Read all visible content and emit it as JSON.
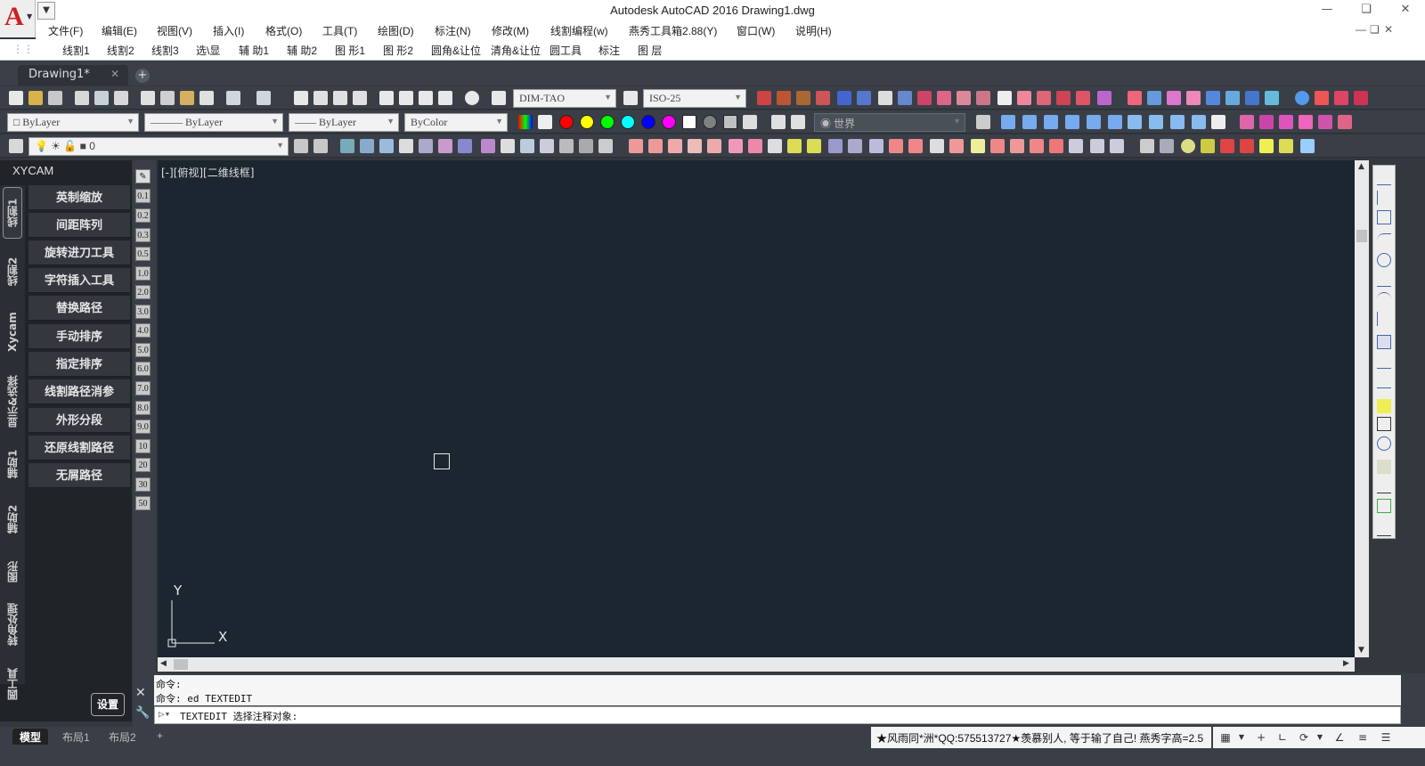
{
  "window": {
    "title": "Autodesk AutoCAD 2016    Drawing1.dwg"
  },
  "app": {
    "logo": "A"
  },
  "menu": [
    "文件(F)",
    "编辑(E)",
    "视图(V)",
    "插入(I)",
    "格式(O)",
    "工具(T)",
    "绘图(D)",
    "标注(N)",
    "修改(M)",
    "线割编程(w)",
    "燕秀工具箱2.88(Y)",
    "窗口(W)",
    "说明(H)"
  ],
  "custom_toolbar": [
    "线割1",
    "线割2",
    "线割3",
    "选\\显",
    "辅 助1",
    "辅 助2",
    "图 形1",
    "图 形2",
    "圆角&让位",
    "清角&让位",
    "圆工具",
    "标注",
    "图 层"
  ],
  "tabs": {
    "active": "Drawing1*"
  },
  "toolbar": {
    "dim_style": "DIM-TAO",
    "iso_style": "ISO-25",
    "color_combo": "ByLayer",
    "linetype_combo": "ByLayer",
    "lineweight_combo": "ByLayer",
    "plotstyle_combo": "ByColor",
    "ucs_combo": "世界",
    "layer_combo": "0",
    "color_swatches": [
      "#ff0000",
      "#ffff00",
      "#00ff00",
      "#00ffff",
      "#0000ff",
      "#ff00ff",
      "#ffffff",
      "#808080",
      "#c0c0c0"
    ]
  },
  "left_panel": {
    "title": "XYCAM",
    "vertical_tabs": [
      "线割1",
      "线割2",
      "Xycam",
      "显示&选择",
      "辅助1",
      "辅助2",
      "图形",
      "转角处理",
      "圆工具"
    ],
    "buttons": [
      "英制缩放",
      "间距阵列",
      "旋转进刀工具",
      "字符插入工具",
      "替换路径",
      "手动排序",
      "指定排序",
      "线割路径消参",
      "外形分段",
      "还原线割路径",
      "无屑路径"
    ],
    "settings": "设置"
  },
  "scale_values": [
    "0.1",
    "0.2",
    "0.3",
    "0.5",
    "1.0",
    "2.0",
    "3.0",
    "4.0",
    "5.0",
    "6.0",
    "7.0",
    "8.0",
    "9.0",
    "10",
    "20",
    "30",
    "50"
  ],
  "canvas": {
    "viewport_label": "[-][俯视][二维线框]",
    "ucs_x": "X",
    "ucs_y": "Y"
  },
  "command": {
    "history": [
      "命令:",
      "命令: ed TEXTEDIT"
    ],
    "input": "TEXTEDIT 选择注释对象:"
  },
  "layout_tabs": [
    "模型",
    "布局1",
    "布局2"
  ],
  "status": {
    "message": "★风雨同*洲*QQ:575513727★羡慕别人, 等于输了自己! 燕秀字高=2.5"
  }
}
